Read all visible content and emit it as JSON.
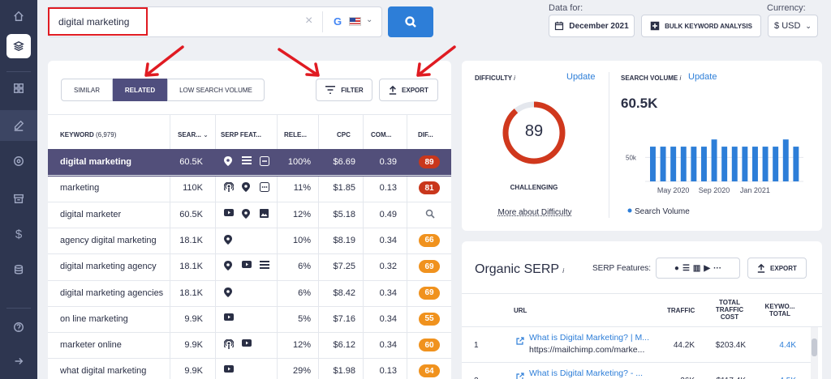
{
  "search": {
    "query": "digital marketing"
  },
  "header": {
    "data_for_label": "Data for:",
    "date": "December 2021",
    "bulk_label": "BULK KEYWORD ANALYSIS",
    "currency_label": "Currency:",
    "currency": "$ USD"
  },
  "tabs": [
    {
      "label": "SIMILAR"
    },
    {
      "label": "RELATED"
    },
    {
      "label": "LOW SEARCH VOLUME"
    }
  ],
  "toolbar": {
    "filter_label": "FILTER",
    "export_label": "EXPORT"
  },
  "table": {
    "headers": [
      "KEYWORD",
      "(6,979)",
      "SEAR...",
      "SERP FEAT...",
      "RELE...",
      "CPC",
      "COM...",
      "DIF..."
    ],
    "rows": [
      {
        "keyword": "digital marketing",
        "volume": "60.5K",
        "relevance": "100%",
        "cpc": "$6.69",
        "comp": "0.39",
        "diff": "89",
        "diff_color": "#c9371c",
        "serp": [
          "pin",
          "list",
          "menu"
        ]
      },
      {
        "keyword": "marketing",
        "volume": "110K",
        "relevance": "11%",
        "cpc": "$1.85",
        "comp": "0.13",
        "diff": "81",
        "diff_color": "#c9371c",
        "serp": [
          "podcast",
          "pin",
          "more"
        ]
      },
      {
        "keyword": "digital marketer",
        "volume": "60.5K",
        "relevance": "12%",
        "cpc": "$5.18",
        "comp": "0.49",
        "diff": "",
        "diff_color": "",
        "serp": [
          "video",
          "pin",
          "image"
        ]
      },
      {
        "keyword": "agency digital marketing",
        "volume": "18.1K",
        "relevance": "10%",
        "cpc": "$8.19",
        "comp": "0.34",
        "diff": "66",
        "diff_color": "#f0921e",
        "serp": [
          "pin"
        ]
      },
      {
        "keyword": "digital marketing agency",
        "volume": "18.1K",
        "relevance": "6%",
        "cpc": "$7.25",
        "comp": "0.32",
        "diff": "69",
        "diff_color": "#f0921e",
        "serp": [
          "pin",
          "video",
          "list"
        ]
      },
      {
        "keyword": "digital marketing agencies",
        "volume": "18.1K",
        "relevance": "6%",
        "cpc": "$8.42",
        "comp": "0.34",
        "diff": "69",
        "diff_color": "#f0921e",
        "serp": [
          "pin"
        ]
      },
      {
        "keyword": "on line marketing",
        "volume": "9.9K",
        "relevance": "5%",
        "cpc": "$7.16",
        "comp": "0.34",
        "diff": "55",
        "diff_color": "#f0921e",
        "serp": [
          "video"
        ]
      },
      {
        "keyword": "marketer online",
        "volume": "9.9K",
        "relevance": "12%",
        "cpc": "$6.12",
        "comp": "0.34",
        "diff": "60",
        "diff_color": "#f0921e",
        "serp": [
          "podcast",
          "video"
        ]
      },
      {
        "keyword": "what digital marketing",
        "volume": "9.9K",
        "relevance": "29%",
        "cpc": "$1.98",
        "comp": "0.13",
        "diff": "64",
        "diff_color": "#f0921e",
        "serp": [
          "video"
        ]
      }
    ]
  },
  "difficulty": {
    "label": "DIFFICULTY",
    "info": "i",
    "update": "Update",
    "value": 89,
    "level": "CHALLENGING",
    "more": "More about Difficulty",
    "ring_color": "#d0381d"
  },
  "search_volume": {
    "label": "SEARCH VOLUME",
    "info": "i",
    "update": "Update",
    "value": "60.5K"
  },
  "chart_data": {
    "type": "bar",
    "title": "",
    "x_ticks": [
      "May 2020",
      "Sep 2020",
      "Jan 2021"
    ],
    "y_ticks": [
      "50k"
    ],
    "ylim": [
      0,
      100
    ],
    "legend": "Search Volume",
    "color": "#2d7ed8",
    "values": [
      58,
      58,
      58,
      58,
      58,
      58,
      70,
      58,
      58,
      58,
      58,
      58,
      58,
      70,
      58
    ]
  },
  "organic_serp": {
    "title": "Organic SERP",
    "info": "i",
    "features_label": "SERP Features:",
    "export_label": "EXPORT",
    "headers": [
      "URL",
      "TRAFFIC",
      "TOTAL TRAFFIC COST",
      "KEYWO... TOTAL"
    ],
    "rows": [
      {
        "rank": "1",
        "title": "What is Digital Marketing? | M...",
        "url": "https://mailchimp.com/marke...",
        "traffic": "44.2K",
        "cost": "$203.4K",
        "keywords": "4.4K"
      },
      {
        "rank": "2",
        "title": "What is Digital Marketing? - ...",
        "url": "",
        "traffic": "26K",
        "cost": "$117.4K",
        "keywords": "4.5K"
      }
    ]
  }
}
